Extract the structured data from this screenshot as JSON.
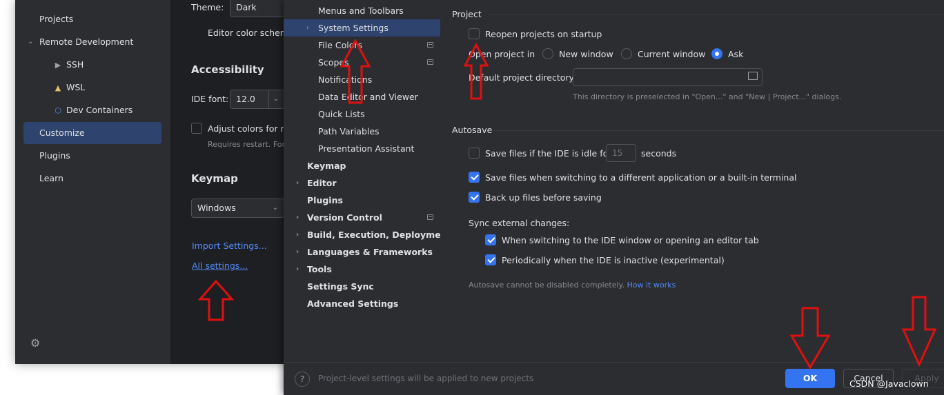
{
  "welcome": {
    "sidebar": {
      "items": [
        {
          "label": "Projects"
        },
        {
          "label": "Remote Development"
        },
        {
          "label": "SSH"
        },
        {
          "label": "WSL"
        },
        {
          "label": "Dev Containers"
        },
        {
          "label": "Customize"
        },
        {
          "label": "Plugins"
        },
        {
          "label": "Learn"
        }
      ]
    },
    "main": {
      "theme_label": "Theme:",
      "theme_value": "Dark",
      "editor_color_scheme_label": "Editor color scheme",
      "accessibility_heading": "Accessibility",
      "ide_font_label": "IDE font:",
      "ide_font_value": "12.0",
      "adjust_colors_label": "Adjust colors for red-green vision deficiency",
      "requires_restart": "Requires restart. For protanopia and deuteranopia",
      "keymap_heading": "Keymap",
      "keymap_value": "Windows",
      "import_settings_link": "Import Settings...",
      "all_settings_link": "All settings..."
    }
  },
  "dialog": {
    "tree": {
      "items": [
        {
          "label": "Menus and Toolbars"
        },
        {
          "label": "System Settings"
        },
        {
          "label": "File Colors"
        },
        {
          "label": "Scopes"
        },
        {
          "label": "Notifications"
        },
        {
          "label": "Data Editor and Viewer"
        },
        {
          "label": "Quick Lists"
        },
        {
          "label": "Path Variables"
        },
        {
          "label": "Presentation Assistant"
        },
        {
          "label": "Keymap"
        },
        {
          "label": "Editor"
        },
        {
          "label": "Plugins"
        },
        {
          "label": "Version Control"
        },
        {
          "label": "Build, Execution, Deployment"
        },
        {
          "label": "Languages & Frameworks"
        },
        {
          "label": "Tools"
        },
        {
          "label": "Settings Sync"
        },
        {
          "label": "Advanced Settings"
        }
      ]
    },
    "project": {
      "title": "Project",
      "reopen_label": "Reopen projects on startup",
      "open_project_label": "Open project in",
      "radio_new_window": "New window",
      "radio_current_window": "Current window",
      "radio_ask": "Ask",
      "default_dir_label": "Default project directory:",
      "default_dir_value": "",
      "default_dir_hint": "This directory is preselected in \"Open...\" and \"New | Project...\" dialogs."
    },
    "autosave": {
      "title": "Autosave",
      "idle_label": "Save files if the IDE is idle for",
      "idle_value": "15",
      "idle_unit": "seconds",
      "switching_label": "Save files when switching to a different application or a built-in terminal",
      "backup_label": "Back up files before saving",
      "sync_label": "Sync external changes:",
      "sync_switch_label": "When switching to the IDE window or opening an editor tab",
      "sync_periodic_label": "Periodically when the IDE is inactive (experimental)",
      "note": "Autosave cannot be disabled completely.",
      "note_link": "How it works"
    },
    "footer": {
      "help": "?",
      "text": "Project-level settings will be applied to new projects",
      "ok": "OK",
      "cancel": "Cancel",
      "apply": "Apply"
    }
  },
  "watermark": "CSDN @Javaclown",
  "colors": {
    "accent": "#3574f0",
    "selection": "#2e436e",
    "annotation": "#e01010",
    "link": "#548af7"
  }
}
